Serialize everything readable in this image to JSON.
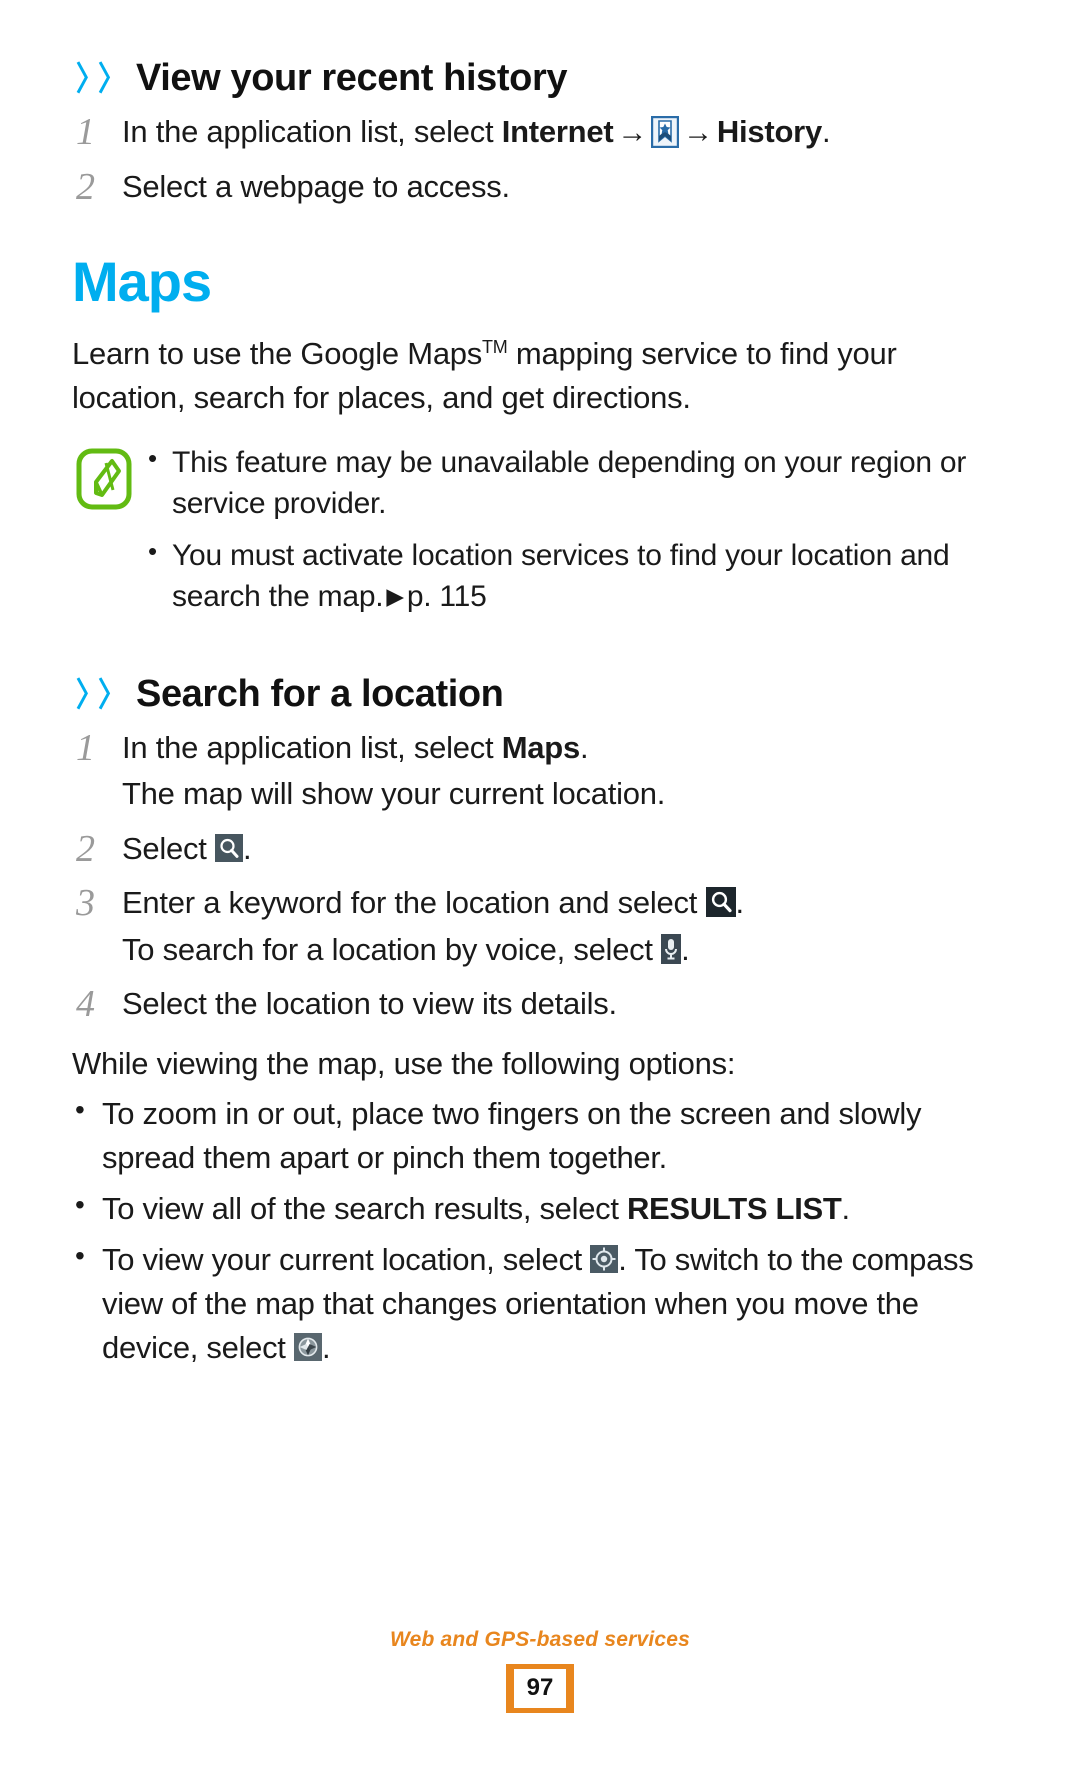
{
  "colors": {
    "accent_cyan": "#00aeef",
    "note_green": "#62bb12",
    "footer_orange": "#e8861e",
    "step_number_gray": "#9a9a9a",
    "icon_dark": "#3b4852",
    "bookmark_blue": "#2a6ca8"
  },
  "section_history": {
    "heading": "View your recent history",
    "chevron": "〉〉",
    "steps": [
      {
        "number": "1",
        "pre": "In the application list, select ",
        "bold1": "Internet",
        "icon": "bookmark-icon",
        "bold2": "History",
        "post": "."
      },
      {
        "number": "2",
        "text": "Select a webpage to access."
      }
    ]
  },
  "section_maps": {
    "heading": "Maps",
    "intro": {
      "before_tm": "Learn to use the Google Maps",
      "tm": "TM",
      "after_tm": " mapping service to find your location, search for places, and get directions."
    },
    "note": {
      "icon": "note-pen-icon",
      "bullets": [
        "This feature may be unavailable depending on your region or service provider.",
        "You must activate location services to find your location and search the map."
      ],
      "bullet2_ref_marker": "▶",
      "bullet2_ref": "p. 115"
    }
  },
  "section_search": {
    "heading": "Search for a location",
    "chevron": "〉〉",
    "steps": [
      {
        "number": "1",
        "line1_pre": "In the application list, select ",
        "line1_bold": "Maps",
        "line1_post": ".",
        "line2": "The map will show your current location."
      },
      {
        "number": "2",
        "pre": "Select ",
        "icon": "search-icon",
        "post": "."
      },
      {
        "number": "3",
        "line1_pre": "Enter a keyword for the location and select ",
        "line1_icon": "search-icon",
        "line1_post": ".",
        "line2_pre": "To search for a location by voice, select ",
        "line2_icon": "microphone-icon",
        "line2_post": "."
      },
      {
        "number": "4",
        "text": "Select the location to view its details."
      }
    ],
    "options_intro": "While viewing the map, use the following options:",
    "options": [
      {
        "text": "To zoom in or out, place two fingers on the screen and slowly spread them apart or pinch them together."
      },
      {
        "pre": "To view all of the search results, select ",
        "bold": "RESULTS LIST",
        "post": "."
      },
      {
        "pre": "To view your current location, select ",
        "icon1": "my-location-icon",
        "mid": ". To switch to the compass view of the map that changes orientation when you move the device, select ",
        "icon2": "compass-icon",
        "post": "."
      }
    ]
  },
  "footer": {
    "title": "Web and GPS-based services",
    "page_number": "97"
  }
}
